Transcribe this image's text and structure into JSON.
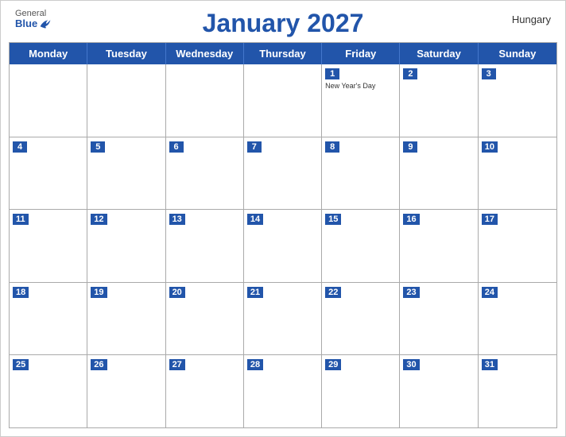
{
  "header": {
    "logo": {
      "general": "General",
      "blue": "Blue"
    },
    "title": "January 2027",
    "country": "Hungary"
  },
  "weekdays": [
    "Monday",
    "Tuesday",
    "Wednesday",
    "Thursday",
    "Friday",
    "Saturday",
    "Sunday"
  ],
  "weeks": [
    [
      {
        "day": "",
        "empty": true
      },
      {
        "day": "",
        "empty": true
      },
      {
        "day": "",
        "empty": true
      },
      {
        "day": "",
        "empty": true
      },
      {
        "day": "1",
        "holiday": "New Year's Day"
      },
      {
        "day": "2",
        "holiday": ""
      },
      {
        "day": "3",
        "holiday": ""
      }
    ],
    [
      {
        "day": "4",
        "holiday": ""
      },
      {
        "day": "5",
        "holiday": ""
      },
      {
        "day": "6",
        "holiday": ""
      },
      {
        "day": "7",
        "holiday": ""
      },
      {
        "day": "8",
        "holiday": ""
      },
      {
        "day": "9",
        "holiday": ""
      },
      {
        "day": "10",
        "holiday": ""
      }
    ],
    [
      {
        "day": "11",
        "holiday": ""
      },
      {
        "day": "12",
        "holiday": ""
      },
      {
        "day": "13",
        "holiday": ""
      },
      {
        "day": "14",
        "holiday": ""
      },
      {
        "day": "15",
        "holiday": ""
      },
      {
        "day": "16",
        "holiday": ""
      },
      {
        "day": "17",
        "holiday": ""
      }
    ],
    [
      {
        "day": "18",
        "holiday": ""
      },
      {
        "day": "19",
        "holiday": ""
      },
      {
        "day": "20",
        "holiday": ""
      },
      {
        "day": "21",
        "holiday": ""
      },
      {
        "day": "22",
        "holiday": ""
      },
      {
        "day": "23",
        "holiday": ""
      },
      {
        "day": "24",
        "holiday": ""
      }
    ],
    [
      {
        "day": "25",
        "holiday": ""
      },
      {
        "day": "26",
        "holiday": ""
      },
      {
        "day": "27",
        "holiday": ""
      },
      {
        "day": "28",
        "holiday": ""
      },
      {
        "day": "29",
        "holiday": ""
      },
      {
        "day": "30",
        "holiday": ""
      },
      {
        "day": "31",
        "holiday": ""
      }
    ]
  ],
  "colors": {
    "header_bg": "#2255aa",
    "header_text": "#ffffff",
    "title_color": "#2255aa"
  }
}
